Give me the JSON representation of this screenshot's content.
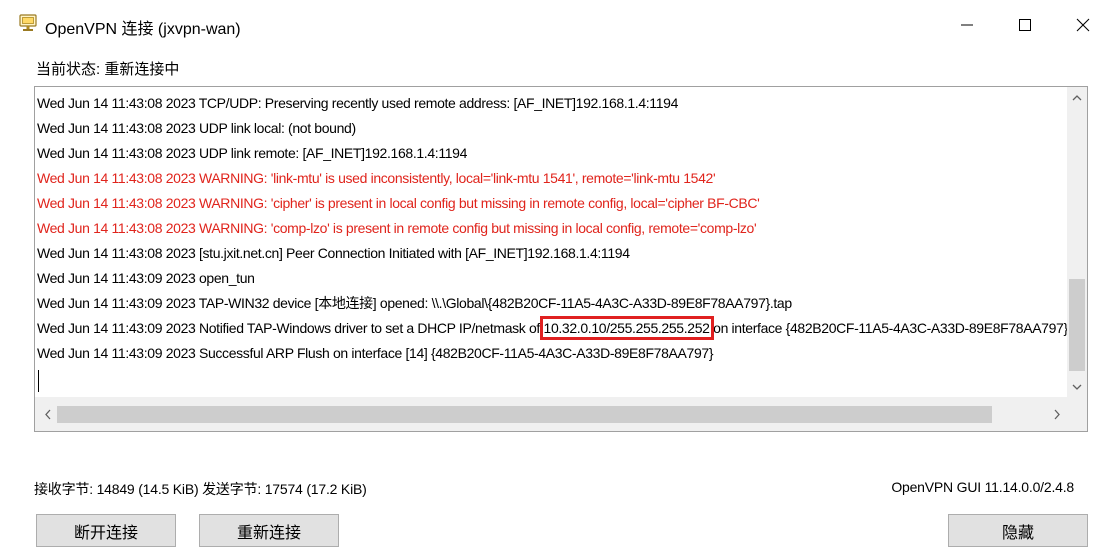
{
  "window": {
    "title": "OpenVPN 连接 (jxvpn-wan)",
    "icon": "openvpn-monitor-icon",
    "controls": [
      "minimize-icon",
      "maximize-icon",
      "close-icon"
    ]
  },
  "status": {
    "text": "当前状态: 重新连接中"
  },
  "log": {
    "lines": [
      {
        "text": "Wed Jun 14 11:43:08 2023 TCP/UDP: Preserving recently used remote address: [AF_INET]192.168.1.4:1194",
        "level": "info"
      },
      {
        "text": "Wed Jun 14 11:43:08 2023 UDP link local: (not bound)",
        "level": "info"
      },
      {
        "text": "Wed Jun 14 11:43:08 2023 UDP link remote: [AF_INET]192.168.1.4:1194",
        "level": "info"
      },
      {
        "text": "Wed Jun 14 11:43:08 2023 WARNING: 'link-mtu' is used inconsistently, local='link-mtu 1541', remote='link-mtu 1542'",
        "level": "warning"
      },
      {
        "text": "Wed Jun 14 11:43:08 2023 WARNING: 'cipher' is present in local config but missing in remote config, local='cipher BF-CBC'",
        "level": "warning"
      },
      {
        "text": "Wed Jun 14 11:43:08 2023 WARNING: 'comp-lzo' is present in remote config but missing in local config, remote='comp-lzo'",
        "level": "warning"
      },
      {
        "text": "Wed Jun 14 11:43:08 2023 [stu.jxit.net.cn] Peer Connection Initiated with [AF_INET]192.168.1.4:1194",
        "level": "info"
      },
      {
        "text": "Wed Jun 14 11:43:09 2023 open_tun",
        "level": "info"
      },
      {
        "text": "Wed Jun 14 11:43:09 2023 TAP-WIN32 device [本地连接] opened: \\\\.\\Global\\{482B20CF-11A5-4A3C-A33D-89E8F78AA797}.tap",
        "level": "info"
      },
      {
        "text": "Wed Jun 14 11:43:09 2023 Notified TAP-Windows driver to set a DHCP IP/netmask of 10.32.0.10/255.255.255.252 on interface {482B20CF-11A5-4A3C-A33D-89E8F78AA797}",
        "level": "info",
        "prefix": "Wed Jun 14 11:43:09 2023 Notified TAP-Windows driver to set a DHCP IP/netmask of ",
        "highlight": "10.32.0.10/255.255.255.252",
        "suffix": " on interface {482B20CF-11A5-4A3C-A33D-89E8F78AA797}"
      },
      {
        "text": "Wed Jun 14 11:43:09 2023 Successful ARP Flush on interface [14] {482B20CF-11A5-4A3C-A33D-89E8F78AA797}",
        "level": "info"
      }
    ]
  },
  "stats": {
    "bytes": "接收字节: 14849 (14.5 KiB) 发送字节: 17574 (17.2 KiB)",
    "version": "OpenVPN GUI 11.14.0.0/2.4.8"
  },
  "buttons": {
    "disconnect": "断开连接",
    "reconnect": "重新连接",
    "hide": "隐藏"
  },
  "colors": {
    "warning_text": "#e0241c",
    "highlight_box": "#e02020"
  }
}
